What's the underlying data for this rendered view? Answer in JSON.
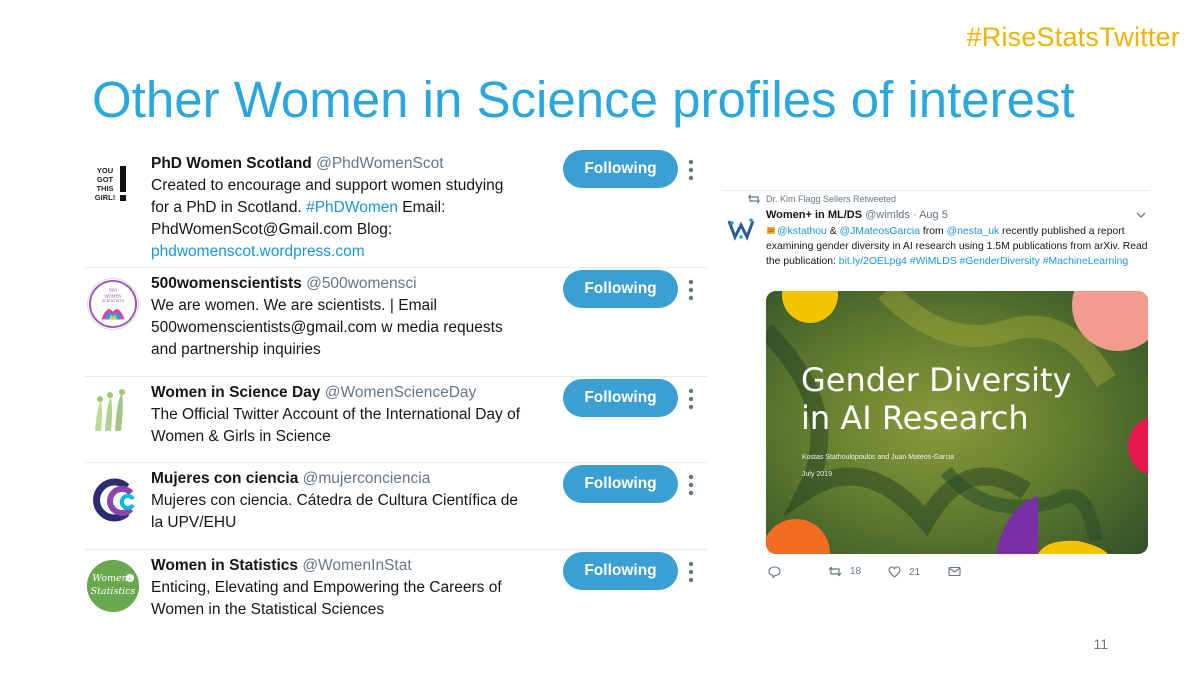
{
  "slide": {
    "hashtag": "#RiseStatsTwitter",
    "title": "Other Women in Science profiles of interest",
    "page_number": "11"
  },
  "accounts": [
    {
      "name": "PhD Women Scotland",
      "handle": "@PhdWomenScot",
      "bio_parts": [
        "Created to encourage and support women studying for a PhD in Scotland. ",
        "#PhDWomen",
        " Email: PhdWomenScot@Gmail.com Blog: ",
        "phdwomenscot.wordpress.com"
      ],
      "avatar_text": [
        "YOU",
        "GOT",
        "THIS",
        "GIRL!"
      ],
      "button": "Following"
    },
    {
      "name": "500womenscientists",
      "handle": "@500womensci",
      "bio": "We are women. We are scientists. | Email 500womenscientists@gmail.com w media requests and partnership inquiries",
      "avatar_text": [
        "500",
        "WOMEN",
        "SCIENTISTS"
      ],
      "button": "Following"
    },
    {
      "name": "Women in Science Day",
      "handle": "@WomenScienceDay",
      "bio": "The Official Twitter Account of the International Day of Women & Girls in Science",
      "button": "Following"
    },
    {
      "name": "Mujeres con ciencia",
      "handle": "@mujerconciencia",
      "bio": "Mujeres con ciencia. Cátedra de Cultura Científica de la UPV/EHU",
      "button": "Following"
    },
    {
      "name": "Women in Statistics",
      "handle": "@WomenInStat",
      "bio": "Enticing, Elevating and Empowering the Careers of Women in the Statistical Sciences",
      "avatar_text": [
        "Women",
        "in",
        "Statistics"
      ],
      "button": "Following"
    }
  ],
  "tweet": {
    "retweeted_by": "Dr. Kim Flagg Sellers Retweeted",
    "author": "Women+ in ML/DS",
    "handle_date": " @wimlds · Aug 5",
    "text_parts": [
      {
        "t": "@kstathou",
        "link": true
      },
      {
        "t": " & ",
        "link": false
      },
      {
        "t": "@JMateosGarcia",
        "link": true
      },
      {
        "t": " from ",
        "link": false
      },
      {
        "t": "@nesta_uk",
        "link": true
      },
      {
        "t": " recently published a report examining gender diversity in AI research using 1.5M publications from arXiv. Read the publication: ",
        "link": false
      },
      {
        "t": "bit.ly/2OELpg4",
        "link": true
      },
      {
        "t": " ",
        "link": false
      },
      {
        "t": "#WiMLDS",
        "link": true
      },
      {
        "t": " ",
        "link": false
      },
      {
        "t": "#GenderDiversity",
        "link": true
      },
      {
        "t": " ",
        "link": false
      },
      {
        "t": "#MachineLearning",
        "link": true
      }
    ],
    "media": {
      "title": "Gender Diversity in AI Research",
      "authors": "Kostas Stathoulopoulos and Juan Mateos-Garcia",
      "date": "July 2019"
    },
    "retweets": "18",
    "likes": "21"
  },
  "colors": {
    "title_blue": "#2aa7df",
    "hashtag_gold": "#f0b400",
    "twitter_blue": "#3b9fd3",
    "link_blue": "#1b95e0"
  }
}
